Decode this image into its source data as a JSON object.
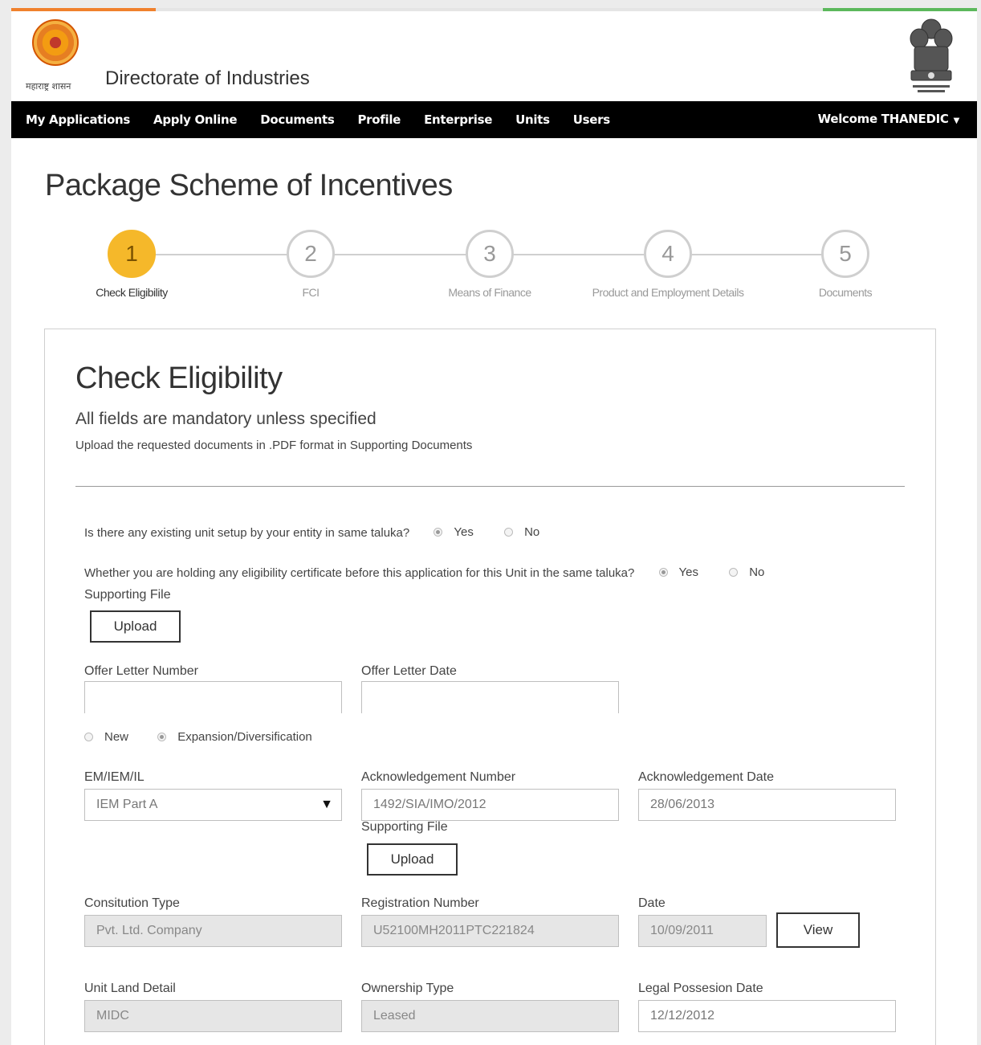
{
  "header": {
    "state_caption": "महाराष्ट्र शासन",
    "site_title": "Directorate of Industries"
  },
  "nav": {
    "items": [
      "My Applications",
      "Apply Online",
      "Documents",
      "Profile",
      "Enterprise",
      "Units",
      "Users"
    ],
    "welcome": "Welcome THANEDIC"
  },
  "page": {
    "title": "Package Scheme of Incentives"
  },
  "wizard": {
    "steps": [
      {
        "number": "1",
        "label": "Check Eligibility",
        "active": true
      },
      {
        "number": "2",
        "label": "FCI",
        "active": false
      },
      {
        "number": "3",
        "label": "Means of Finance",
        "active": false
      },
      {
        "number": "4",
        "label": "Product and Employment Details",
        "active": false
      },
      {
        "number": "5",
        "label": "Documents",
        "active": false
      }
    ]
  },
  "form": {
    "title": "Check Eligibility",
    "subtitle": "All fields are mandatory unless specified",
    "note": "Upload the requested documents in .PDF format in Supporting Documents",
    "q1": {
      "text": "Is there any existing unit setup by your entity in same taluka?",
      "yes": "Yes",
      "no": "No",
      "selected": "Yes"
    },
    "q2": {
      "text": "Whether you are holding any eligibility certificate before this application for this Unit in the same taluka?",
      "yes": "Yes",
      "no": "No",
      "selected": "Yes"
    },
    "supporting_file_label": "Supporting File",
    "upload_label": "Upload",
    "offer_letter_number_label": "Offer Letter Number",
    "offer_letter_number_value": "",
    "offer_letter_date_label": "Offer Letter Date",
    "offer_letter_date_value": "",
    "unit_type": {
      "new": "New",
      "expansion": "Expansion/Diversification",
      "selected": "Expansion/Diversification"
    },
    "em_label": "EM/IEM/IL",
    "em_value": "IEM Part A",
    "ack_number_label": "Acknowledgement Number",
    "ack_number_value": "1492/SIA/IMO/2012",
    "ack_date_label": "Acknowledgement Date",
    "ack_date_value": "28/06/2013",
    "constitution_label": "Consitution Type",
    "constitution_value": "Pvt. Ltd. Company",
    "registration_label": "Registration Number",
    "registration_value": "U52100MH2011PTC221824",
    "date_label": "Date",
    "date_value": "10/09/2011",
    "view_label": "View",
    "land_label": "Unit Land Detail",
    "land_value": "MIDC",
    "ownership_label": "Ownership Type",
    "ownership_value": "Leased",
    "possession_label": "Legal Possesion Date",
    "possession_value": "12/12/2012"
  },
  "colors": {
    "accent_orange": "#f0812d",
    "accent_green": "#5cb85c",
    "active_step": "#f5b82a",
    "navbar": "#000000"
  }
}
